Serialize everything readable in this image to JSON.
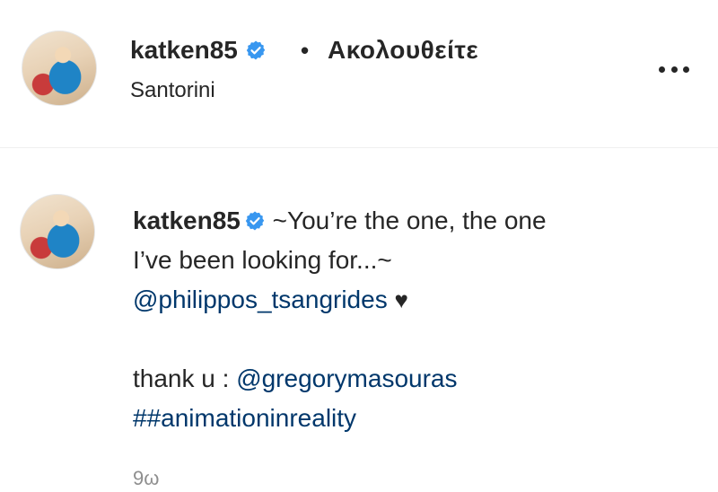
{
  "header": {
    "username": "katken85",
    "separator": "•",
    "follow_label": "Ακολουθείτε",
    "location": "Santorini"
  },
  "comment": {
    "username": "katken85",
    "caption_line1": "~You’re the one, the one",
    "caption_line2": "I’ve been looking for...~",
    "mention1": "@philippos_tsangrides",
    "heart": "♥",
    "thanks_prefix": "thank u : ",
    "mention2": "@gregorymasouras",
    "hashtag": "##animationinreality",
    "time": "9ω"
  },
  "icons": {
    "verified": "verified-badge-icon",
    "more": "more-options-icon"
  },
  "colors": {
    "verified": "#3897f0",
    "link": "#00376b",
    "secondary_text": "#8e8e8e"
  }
}
